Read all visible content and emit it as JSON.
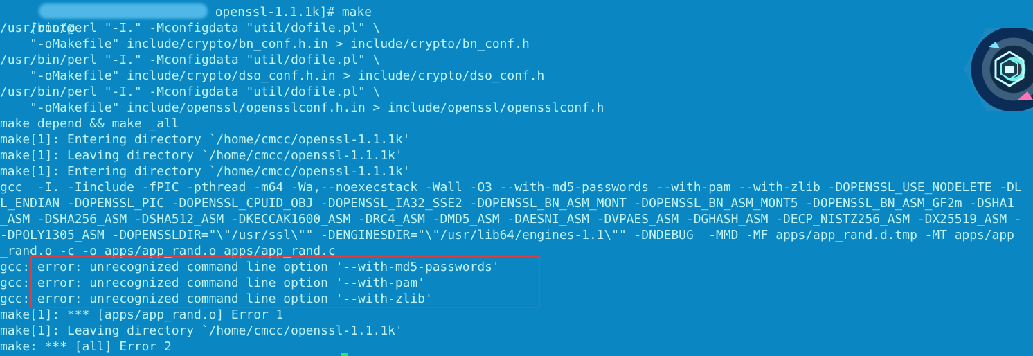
{
  "colors": {
    "background": "#0a87c3",
    "text": "#bff3f3",
    "highlight_border": "#e23c3c",
    "redaction": "#4fb8e6",
    "cursor": "#2de36b"
  },
  "terminal": {
    "prompt_prefix": "[root@",
    "prompt_suffix": " openssl-1.1.1k]# make",
    "lines": [
      "/usr/bin/perl \"-I.\" -Mconfigdata \"util/dofile.pl\" \\",
      "    \"-oMakefile\" include/crypto/bn_conf.h.in > include/crypto/bn_conf.h",
      "/usr/bin/perl \"-I.\" -Mconfigdata \"util/dofile.pl\" \\",
      "    \"-oMakefile\" include/crypto/dso_conf.h.in > include/crypto/dso_conf.h",
      "/usr/bin/perl \"-I.\" -Mconfigdata \"util/dofile.pl\" \\",
      "    \"-oMakefile\" include/openssl/opensslconf.h.in > include/openssl/opensslconf.h",
      "make depend && make _all",
      "make[1]: Entering directory `/home/cmcc/openssl-1.1.1k'",
      "make[1]: Leaving directory `/home/cmcc/openssl-1.1.1k'",
      "make[1]: Entering directory `/home/cmcc/openssl-1.1.1k'",
      "gcc  -I. -Iinclude -fPIC -pthread -m64 -Wa,--noexecstack -Wall -O3 --with-md5-passwords --with-pam --with-zlib -DOPENSSL_USE_NODELETE -DL",
      "L_ENDIAN -DOPENSSL_PIC -DOPENSSL_CPUID_OBJ -DOPENSSL_IA32_SSE2 -DOPENSSL_BN_ASM_MONT -DOPENSSL_BN_ASM_MONT5 -DOPENSSL_BN_ASM_GF2m -DSHA1",
      "_ASM -DSHA256_ASM -DSHA512_ASM -DKECCAK1600_ASM -DRC4_ASM -DMD5_ASM -DAESNI_ASM -DVPAES_ASM -DGHASH_ASM -DECP_NISTZ256_ASM -DX25519_ASM -",
      "-DPOLY1305_ASM -DOPENSSLDIR=\"\\\"/usr/ssl\\\"\" -DENGINESDIR=\"\\\"/usr/lib64/engines-1.1\\\"\" -DNDEBUG  -MMD -MF apps/app_rand.d.tmp -MT apps/app",
      "_rand.o -c -o apps/app_rand.o apps/app_rand.c",
      "gcc: error: unrecognized command line option '--with-md5-passwords'",
      "gcc: error: unrecognized command line option '--with-pam'",
      "gcc: error: unrecognized command line option '--with-zlib'",
      "make[1]: *** [apps/app_rand.o] Error 1",
      "make[1]: Leaving directory `/home/cmcc/openssl-1.1.1k'",
      "make: *** [all] Error 2"
    ]
  },
  "icons": {
    "redaction": "blurred-hostname",
    "avatar": "hexagon-avatar-icon",
    "cursor": "terminal-cursor-icon"
  }
}
